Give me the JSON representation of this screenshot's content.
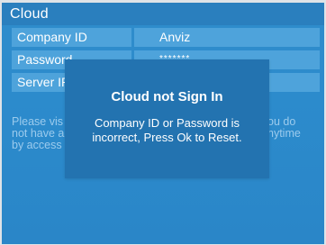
{
  "header": {
    "title": "Cloud"
  },
  "form": {
    "rows": [
      {
        "label": "Company ID",
        "value": "Anviz"
      },
      {
        "label": "Password",
        "value": "*******"
      },
      {
        "label": "Server IP",
        "value": ""
      }
    ]
  },
  "help": {
    "left_lines": [
      "Please vis",
      "not have a",
      "by access"
    ],
    "right_lines": [
      "ou do",
      "nytime"
    ]
  },
  "dialog": {
    "title": "Cloud not Sign In",
    "message_lines": [
      "Company ID or Password is",
      "incorrect, Press Ok to Reset."
    ]
  },
  "colors": {
    "background": "#2c8bcc",
    "header": "#2a7fbe",
    "field": "#4ea3db",
    "dialog": "#2373b0",
    "help_text": "#9ccbed"
  }
}
